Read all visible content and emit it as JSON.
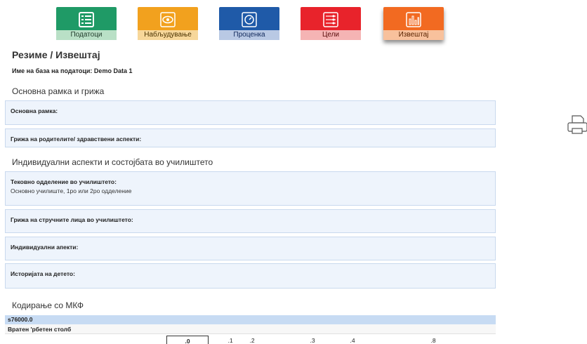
{
  "nav": {
    "tabs": [
      {
        "label": "Податоци",
        "icon": "list-icon",
        "color": "#1f9a66"
      },
      {
        "label": "Набљудување",
        "icon": "eye-icon",
        "color": "#f2a11e"
      },
      {
        "label": "Проценка",
        "icon": "gauge-icon",
        "color": "#1f5aa8"
      },
      {
        "label": "Цели",
        "icon": "sliders-icon",
        "color": "#e8232b"
      },
      {
        "label": "Извештај",
        "icon": "bar-chart-icon",
        "color": "#f26a21",
        "active": true
      }
    ]
  },
  "page": {
    "title": "Резиме / Извештај",
    "db_name": "Име на база на податоци: Demo Data 1"
  },
  "sections": {
    "framework": {
      "title": "Основна рамка и грижа",
      "fields": [
        {
          "label": "Основна рамка:",
          "value": ""
        },
        {
          "label": "Грижа на родителите/ здравствени аспекти:",
          "value": ""
        }
      ]
    },
    "individual": {
      "title": "Индивидуални аспекти и состојбата во училиштето",
      "fields": [
        {
          "label": "Тековно одделение во училиштето:",
          "value": "Основно училиште, 1ро или 2ро одделение"
        },
        {
          "label": "Грижа на стручните лица во училиштето:",
          "value": ""
        },
        {
          "label": "Индивидуални апекти:",
          "value": ""
        },
        {
          "label": "Историјата на детето:",
          "value": ""
        }
      ]
    },
    "icf": {
      "title": "Кодирање со МКФ",
      "code": "s76000.0",
      "description": "Вратен 'рбетен столб",
      "qualifiers": [
        ".0",
        ".1",
        ".2",
        ".3",
        ".4",
        ".8"
      ],
      "selected_qualifier": ".0"
    }
  },
  "toolbar": {
    "print_icon": "printer-icon"
  }
}
